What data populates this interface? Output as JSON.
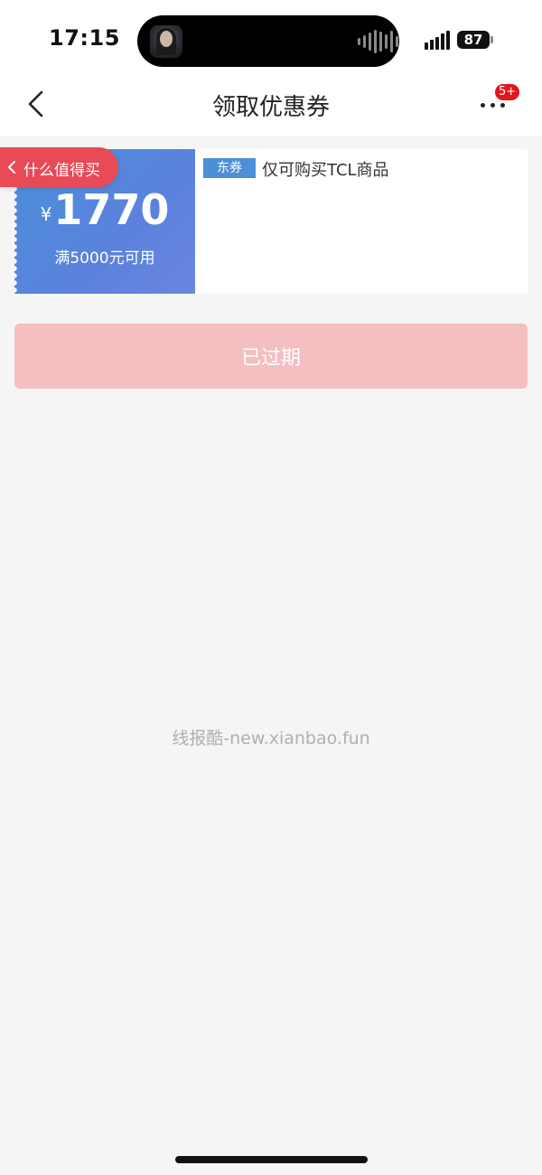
{
  "status_bar": {
    "time": "17:15",
    "battery": "87"
  },
  "nav": {
    "title": "领取优惠券",
    "badge": "5+",
    "badge_color": "#e4161c"
  },
  "coupon": {
    "currency": "¥",
    "amount": "1770",
    "condition": "满5000元可用",
    "tag": "东券",
    "description": "仅可购买TCL商品",
    "gradient_colors": [
      "#4a90d9",
      "#6a86de"
    ]
  },
  "floating_pill": {
    "label": "什么值得买",
    "color": "#e84a56"
  },
  "action": {
    "expired_label": "已过期",
    "color": "#f3bfc1"
  },
  "watermark": "线报酷-new.xianbao.fun",
  "icons": {
    "back": "chevron-left-icon",
    "more": "more-dots-icon",
    "pill_back": "chevron-left-icon"
  }
}
